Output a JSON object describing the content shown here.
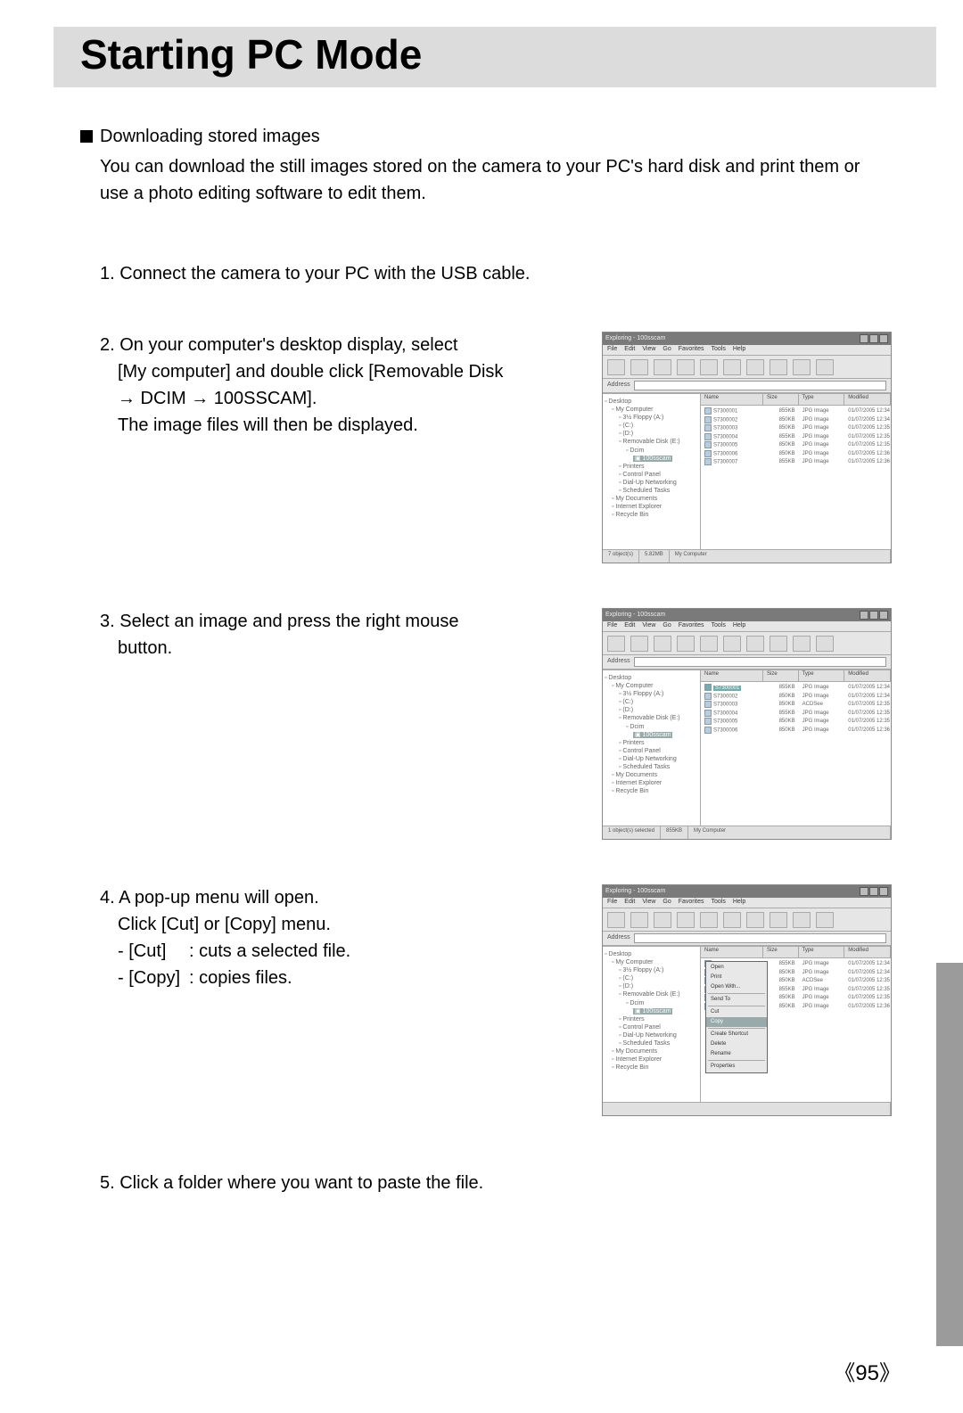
{
  "title": "Starting PC Mode",
  "heading": "Downloading stored images",
  "intro": "You can download the still images stored on the camera to your PC's hard disk and print them or use a photo editing software to edit them.",
  "steps": {
    "s1": "1. Connect the camera to your PC with the USB cable.",
    "s2a": "2. On your computer's desktop display, select",
    "s2b": "[My computer] and double click [Removable Disk",
    "s2c": "→ DCIM → 100SSCAM].",
    "s2d": "The image files will then be displayed.",
    "s3a": "3. Select an image and press the right mouse",
    "s3b": "button.",
    "s4a": "4. A pop-up menu will open.",
    "s4b": "Click [Cut] or [Copy] menu.",
    "s4c_key": "- [Cut]",
    "s4c_val": ": cuts a selected file.",
    "s4d_key": "- [Copy]",
    "s4d_val": ": copies files.",
    "s5": "5. Click a folder where you want to paste the file."
  },
  "explorer": {
    "title": "Exploring - 100sscam",
    "menu": [
      "File",
      "Edit",
      "View",
      "Go",
      "Favorites",
      "Tools",
      "Help"
    ],
    "addr_label": "Address",
    "cols": [
      "Name",
      "Size",
      "Type",
      "Modified"
    ],
    "tree": [
      {
        "lvl": 0,
        "t": "Desktop"
      },
      {
        "lvl": 1,
        "t": "My Computer"
      },
      {
        "lvl": 2,
        "t": "3½ Floppy (A:)"
      },
      {
        "lvl": 2,
        "t": "(C:)"
      },
      {
        "lvl": 2,
        "t": "(D:)"
      },
      {
        "lvl": 2,
        "t": "Removable Disk (E:)"
      },
      {
        "lvl": 3,
        "t": "Dcim"
      },
      {
        "lvl": 4,
        "t": "100sscam",
        "sel": true
      },
      {
        "lvl": 2,
        "t": "Printers"
      },
      {
        "lvl": 2,
        "t": "Control Panel"
      },
      {
        "lvl": 2,
        "t": "Dial-Up Networking"
      },
      {
        "lvl": 2,
        "t": "Scheduled Tasks"
      },
      {
        "lvl": 1,
        "t": "My Documents"
      },
      {
        "lvl": 1,
        "t": "Internet Explorer"
      },
      {
        "lvl": 1,
        "t": "Recycle Bin"
      }
    ],
    "rows": [
      {
        "n": "S7300001",
        "s": "855KB",
        "t": "JPG Image",
        "m": "01/07/2005 12:34"
      },
      {
        "n": "S7300002",
        "s": "850KB",
        "t": "JPG Image",
        "m": "01/07/2005 12:34"
      },
      {
        "n": "S7300003",
        "s": "850KB",
        "t": "JPG Image",
        "m": "01/07/2005 12:35"
      },
      {
        "n": "S7300004",
        "s": "855KB",
        "t": "JPG Image",
        "m": "01/07/2005 12:35"
      },
      {
        "n": "S7300005",
        "s": "850KB",
        "t": "JPG Image",
        "m": "01/07/2005 12:35"
      },
      {
        "n": "S7300006",
        "s": "850KB",
        "t": "JPG Image",
        "m": "01/07/2005 12:36"
      },
      {
        "n": "S7300007",
        "s": "855KB",
        "t": "JPG Image",
        "m": "01/07/2005 12:36"
      }
    ],
    "rows_b": [
      {
        "n": "S7300001",
        "s": "855KB",
        "t": "JPG Image",
        "m": "01/07/2005 12:34",
        "sel": true
      },
      {
        "n": "S7300002",
        "s": "850KB",
        "t": "JPG Image",
        "m": "01/07/2005 12:34"
      },
      {
        "n": "S7300003",
        "s": "850KB",
        "t": "ACDSee",
        "m": "01/07/2005 12:35"
      },
      {
        "n": "S7300004",
        "s": "855KB",
        "t": "JPG Image",
        "m": "01/07/2005 12:35"
      },
      {
        "n": "S7300005",
        "s": "850KB",
        "t": "JPG Image",
        "m": "01/07/2005 12:35"
      },
      {
        "n": "S7300006",
        "s": "850KB",
        "t": "JPG Image",
        "m": "01/07/2005 12:36"
      }
    ],
    "status_left": "7 object(s)",
    "status_mid": "5.82MB",
    "status_right": "My Computer",
    "status_b_left": "1 object(s) selected",
    "status_b_mid": "855KB",
    "popup": [
      "Open",
      "Print",
      "Open With...",
      "",
      "Send To",
      "",
      "Cut",
      "Copy",
      "",
      "Create Shortcut",
      "Delete",
      "Rename",
      "",
      "Properties"
    ]
  },
  "pagenum": "95"
}
